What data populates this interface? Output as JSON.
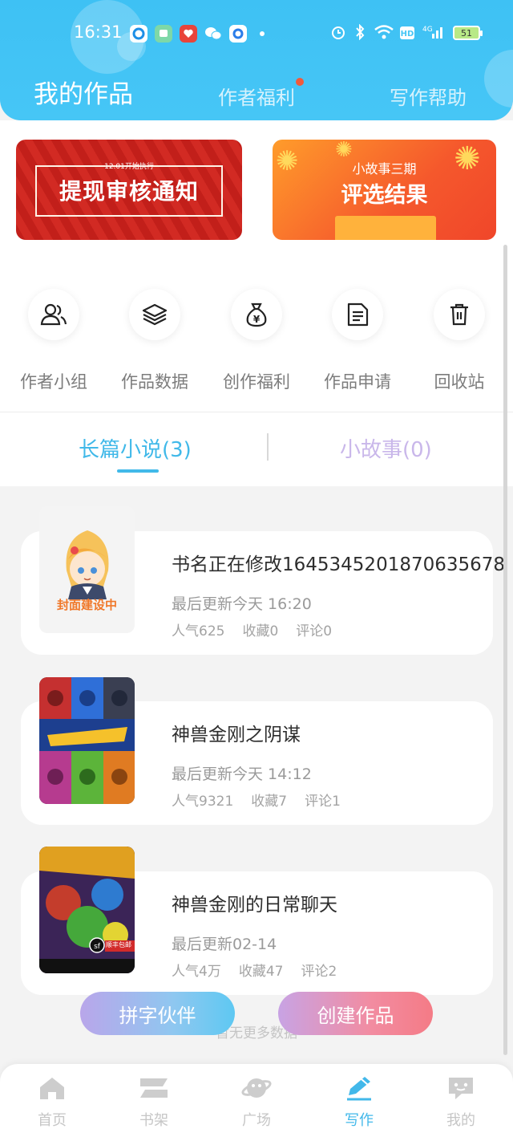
{
  "status_bar": {
    "time": "16:31",
    "battery": "51",
    "icons": [
      "target-icon",
      "chat-bubble-icon",
      "red-app-icon",
      "wechat-icon",
      "browser-icon",
      "dot-icon",
      "alarm-icon",
      "bluetooth-icon",
      "wifi-icon",
      "hd-icon",
      "signal-4g-icon"
    ]
  },
  "header": {
    "tabs": [
      {
        "label": "我的作品",
        "active": true
      },
      {
        "label": "作者福利",
        "active": false,
        "badge": true
      },
      {
        "label": "写作帮助",
        "active": false
      }
    ]
  },
  "banners": {
    "left": {
      "subtitle": "12.01开始执行",
      "title": "提现审核通知"
    },
    "right": {
      "line1": "小故事三期",
      "line2": "评选结果"
    }
  },
  "quick_actions": [
    {
      "label": "作者小组",
      "icon": "group-icon"
    },
    {
      "label": "作品数据",
      "icon": "layers-icon"
    },
    {
      "label": "创作福利",
      "icon": "money-bag-icon"
    },
    {
      "label": "作品申请",
      "icon": "document-icon"
    },
    {
      "label": "回收站",
      "icon": "trash-icon"
    }
  ],
  "work_tabs": [
    {
      "label": "长篇小说(3)",
      "active": true
    },
    {
      "label": "小故事(0)",
      "active": false
    }
  ],
  "books": [
    {
      "title": "书名正在修改1645345201870635678",
      "updated": "最后更新今天 16:20",
      "popularity": "人气625",
      "favorites": "收藏0",
      "comments": "评论0",
      "cover_text": "封面建设中"
    },
    {
      "title": "神兽金刚之阴谋",
      "updated": "最后更新今天 14:12",
      "popularity": "人气9321",
      "favorites": "收藏7",
      "comments": "评论1"
    },
    {
      "title": "神兽金刚的日常聊天",
      "updated": "最后更新02-14",
      "popularity": "人气4万",
      "favorites": "收藏47",
      "comments": "评论2",
      "cover_text": "顺丰包邮"
    }
  ],
  "no_more": "暂无更多数据",
  "buttons": {
    "partner": "拼字伙伴",
    "create": "创建作品"
  },
  "bottom_nav": [
    {
      "label": "首页",
      "icon": "home-icon",
      "active": false
    },
    {
      "label": "书架",
      "icon": "bookshelf-icon",
      "active": false
    },
    {
      "label": "广场",
      "icon": "planet-icon",
      "active": false
    },
    {
      "label": "写作",
      "icon": "pen-icon",
      "active": true
    },
    {
      "label": "我的",
      "icon": "message-face-icon",
      "active": false
    }
  ],
  "colors": {
    "accent": "#41b9e9",
    "header": "#3ec1f4",
    "inactive_tab": "#c9b7ea"
  }
}
